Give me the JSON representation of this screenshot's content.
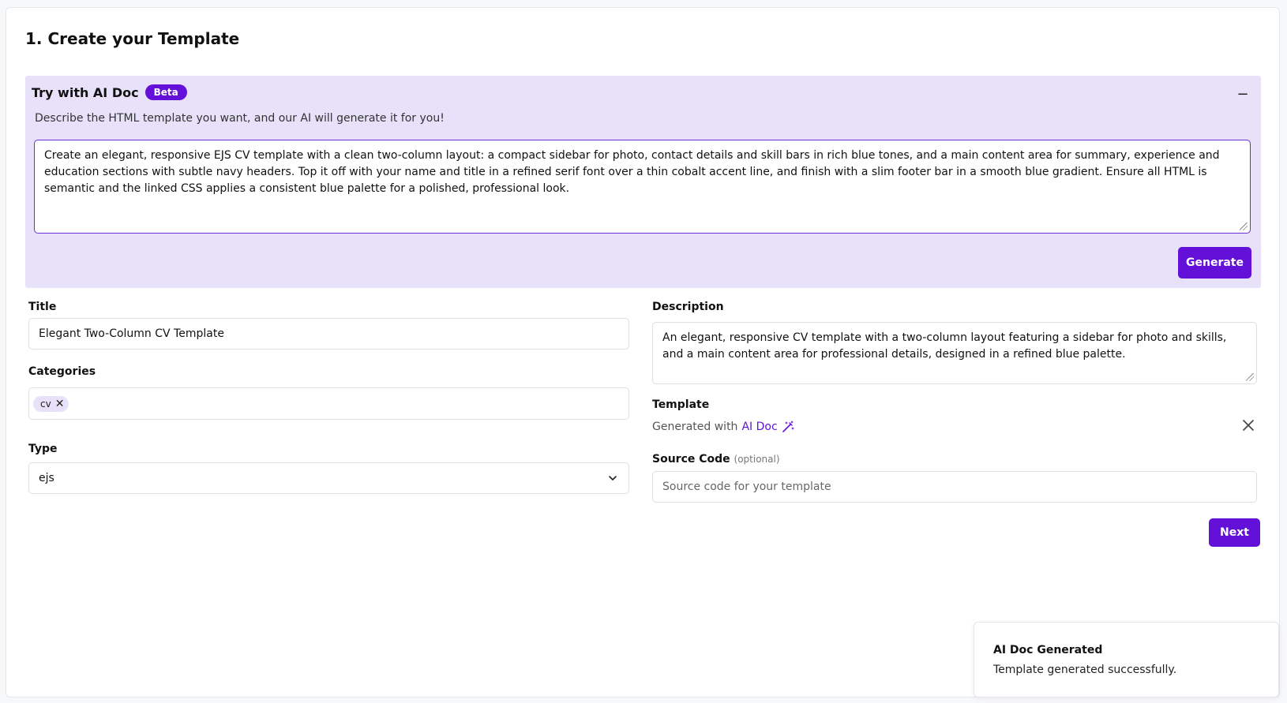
{
  "page": {
    "title": "1. Create your Template"
  },
  "ai_panel": {
    "title": "Try with AI Doc",
    "badge": "Beta",
    "collapse_symbol": "−",
    "subtitle": "Describe the HTML template you want, and our AI will generate it for you!",
    "prompt": "Create an elegant, responsive EJS CV template with a clean two-column layout: a compact sidebar for photo, contact details and skill bars in rich blue tones, and a main content area for summary, experience and education sections with subtle navy headers. Top it off with your name and title in a refined serif font over a thin cobalt accent line, and finish with a slim footer bar in a smooth blue gradient. Ensure all HTML is semantic and the linked CSS applies a consistent blue palette for a polished, professional look.",
    "generate_label": "Generate"
  },
  "form": {
    "title_label": "Title",
    "title_value": "Elegant Two-Column CV Template",
    "categories_label": "Categories",
    "categories": [
      "cv"
    ],
    "type_label": "Type",
    "type_value": "ejs",
    "description_label": "Description",
    "description_value": "An elegant, responsive CV template with a two-column layout featuring a sidebar for photo and skills, and a main content area for professional details, designed in a refined blue palette.",
    "template_label": "Template",
    "generated_prefix": "Generated with",
    "generated_link": "AI Doc",
    "source_label": "Source Code",
    "source_optional": "(optional)",
    "source_placeholder": "Source code for your template",
    "next_label": "Next"
  },
  "toast": {
    "title": "AI Doc Generated",
    "message": "Template generated successfully."
  },
  "colors": {
    "accent": "#6311d8",
    "panel_bg": "#e8e1fa"
  },
  "icons": [
    "minus-icon",
    "close-icon",
    "chevron-down-icon",
    "magic-wand-icon"
  ]
}
